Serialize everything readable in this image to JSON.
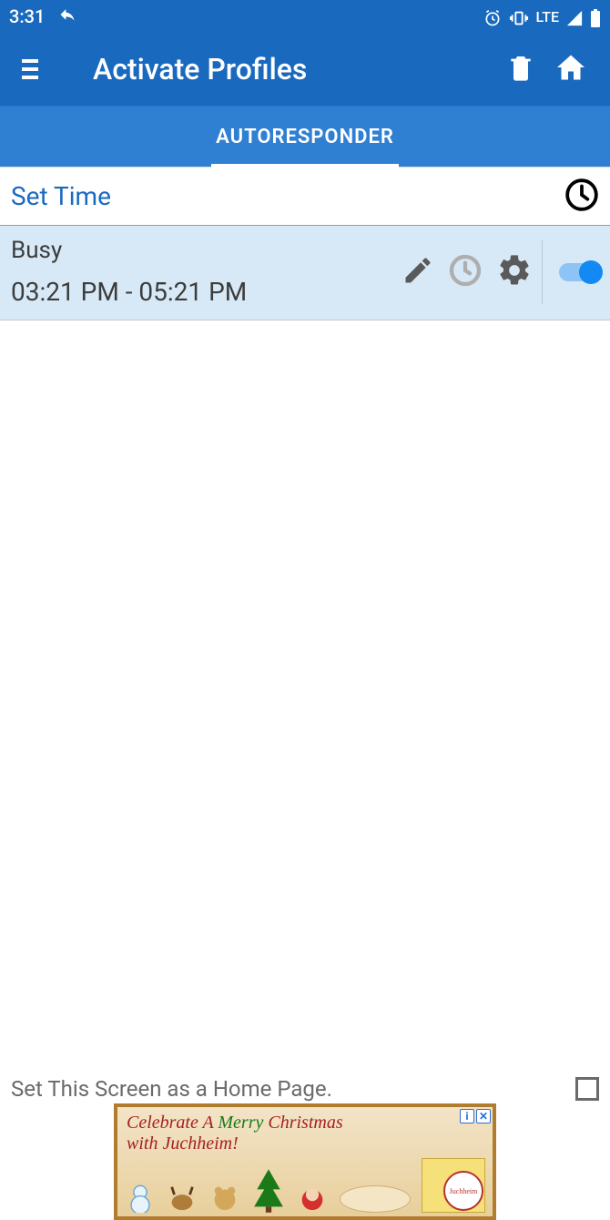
{
  "status": {
    "time": "3:31",
    "network": "LTE"
  },
  "header": {
    "title": "Activate Profiles"
  },
  "tabs": {
    "autoresponder": "AUTORESPONDER"
  },
  "set_time": {
    "label": "Set Time"
  },
  "profile": {
    "name": "Busy",
    "time_range": "03:21 PM - 05:21 PM",
    "enabled": true
  },
  "footer": {
    "home_page_label": "Set This Screen as a Home Page.",
    "home_page_checked": false
  },
  "ad": {
    "line1_a": "Celebrate A ",
    "line1_b": "Merry",
    "line1_c": " Christmas",
    "line2": "with Juchheim!",
    "brand": "Juchheim",
    "info": "i",
    "close": "✕"
  }
}
